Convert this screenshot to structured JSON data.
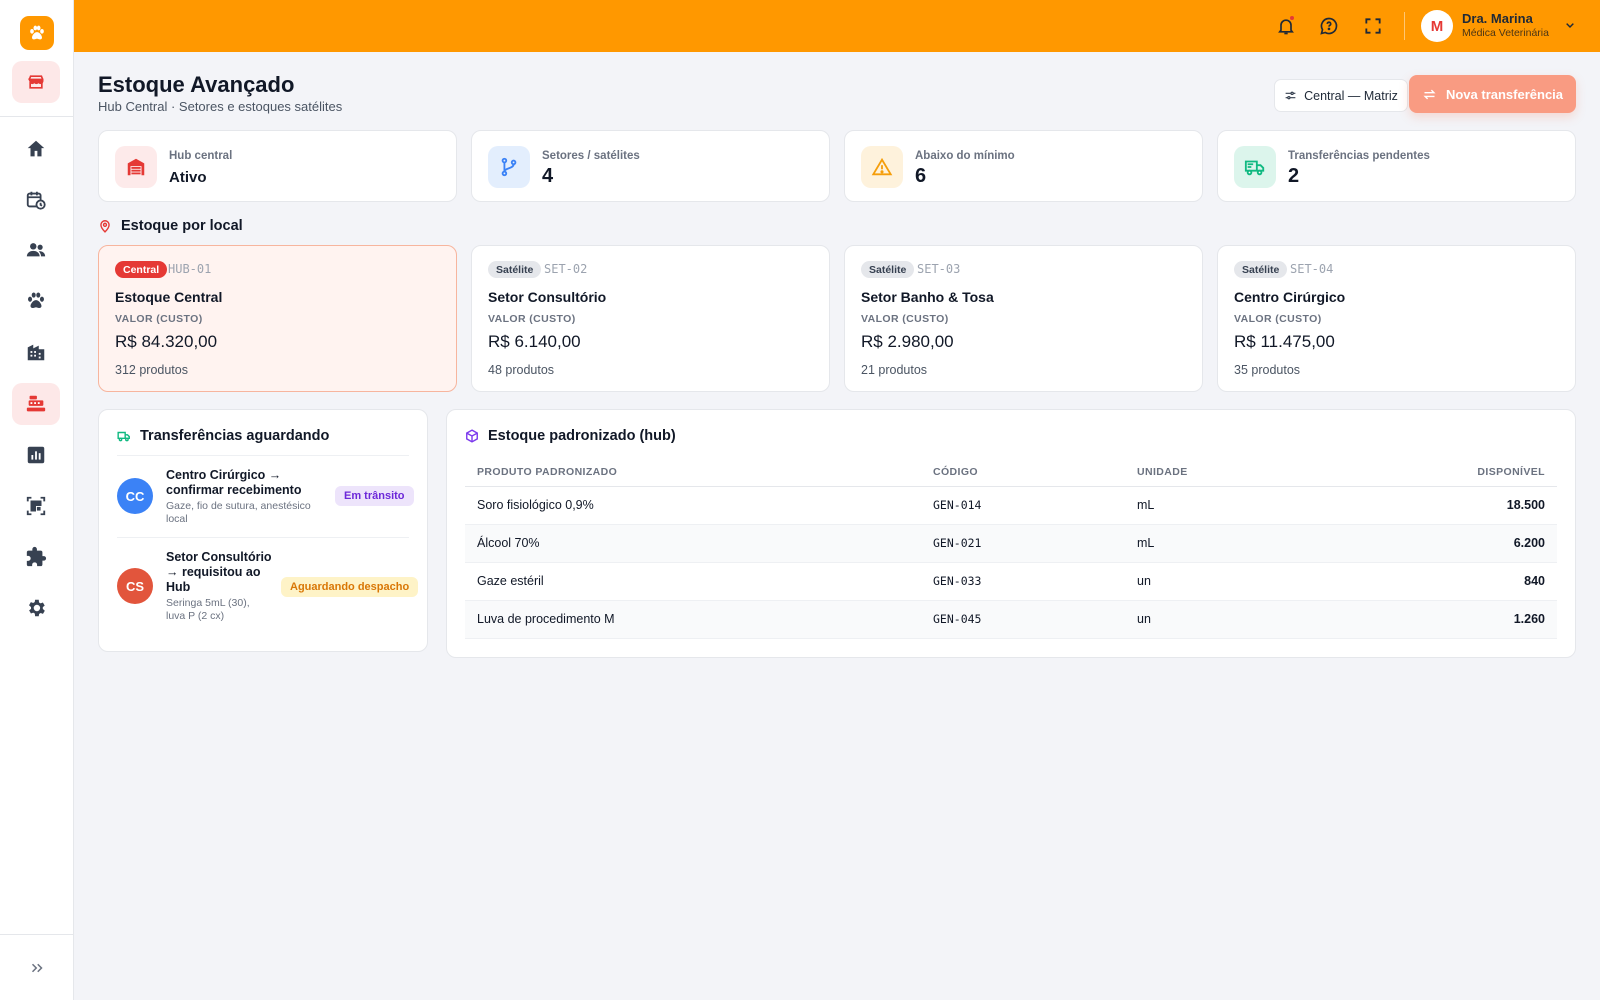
{
  "topbar": {
    "user_initial": "M",
    "user_name": "Dra. Marina",
    "user_role": "Médica Veterinária"
  },
  "colors": {
    "brand_orange": "#ff9800",
    "accent_red": "#e53935",
    "button_salmon": "#f99b82"
  },
  "sidebar": {
    "items": [
      {
        "name": "home-icon"
      },
      {
        "name": "calendar-clock-icon"
      },
      {
        "name": "people-icon"
      },
      {
        "name": "paw-icon"
      },
      {
        "name": "building-icon"
      },
      {
        "name": "inventory-icon",
        "active": true
      },
      {
        "name": "bar-chart-icon"
      },
      {
        "name": "qr-code-icon"
      },
      {
        "name": "puzzle-icon"
      },
      {
        "name": "gear-icon"
      }
    ]
  },
  "header": {
    "title": "Estoque Avançado",
    "subtitle": "Hub Central · Setores e estoques satélites",
    "location_button": "Central — Matriz",
    "new_transfer_button": "Nova transferência"
  },
  "stats": [
    {
      "label": "Hub central",
      "value": "Ativo"
    },
    {
      "label": "Setores / satélites",
      "value": "4"
    },
    {
      "label": "Abaixo do mínimo",
      "value": "6"
    },
    {
      "label": "Transferências pendentes",
      "value": "2"
    }
  ],
  "locations_section": {
    "title": "Estoque por local",
    "value_label": "VALOR (CUSTO)",
    "items": [
      {
        "badge": "Central",
        "code": "HUB-01",
        "name": "Estoque Central",
        "value": "R$ 84.320,00",
        "count": "312 produtos"
      },
      {
        "badge": "Satélite",
        "code": "SET-02",
        "name": "Setor Consultório",
        "value": "R$ 6.140,00",
        "count": "48 produtos"
      },
      {
        "badge": "Satélite",
        "code": "SET-03",
        "name": "Setor Banho & Tosa",
        "value": "R$ 2.980,00",
        "count": "21 produtos"
      },
      {
        "badge": "Satélite",
        "code": "SET-04",
        "name": "Centro Cirúrgico",
        "value": "R$ 11.475,00",
        "count": "35 produtos"
      }
    ]
  },
  "transfers": {
    "title": "Transferências aguardando",
    "items": [
      {
        "initials": "CC",
        "title_line1": "Centro Cirúrgico →",
        "title_line2": "confirmar recebimento",
        "desc_line1": "Gaze, fio de sutura, anestésico",
        "desc_line2": "local",
        "status": "Em trânsito",
        "avatar_color": "#3b82f6"
      },
      {
        "initials": "CS",
        "title_line1": "Setor Consultório",
        "title_line2": "→ requisitou ao",
        "title_line3": "Hub",
        "desc_line1": "Seringa 5mL (30),",
        "desc_line2": "luva P (2 cx)",
        "status": "Aguardando despacho",
        "avatar_color": "#e2553c"
      }
    ]
  },
  "standard_stock": {
    "title": "Estoque padronizado (hub)",
    "columns": [
      "PRODUTO PADRONIZADO",
      "CÓDIGO",
      "UNIDADE",
      "DISPONÍVEL"
    ],
    "rows": [
      {
        "product": "Soro fisiológico 0,9%",
        "code": "GEN-014",
        "unit": "mL",
        "available": "18.500"
      },
      {
        "product": "Álcool 70%",
        "code": "GEN-021",
        "unit": "mL",
        "available": "6.200"
      },
      {
        "product": "Gaze estéril",
        "code": "GEN-033",
        "unit": "un",
        "available": "840"
      },
      {
        "product": "Luva de procedimento M",
        "code": "GEN-045",
        "unit": "un",
        "available": "1.260"
      }
    ]
  }
}
